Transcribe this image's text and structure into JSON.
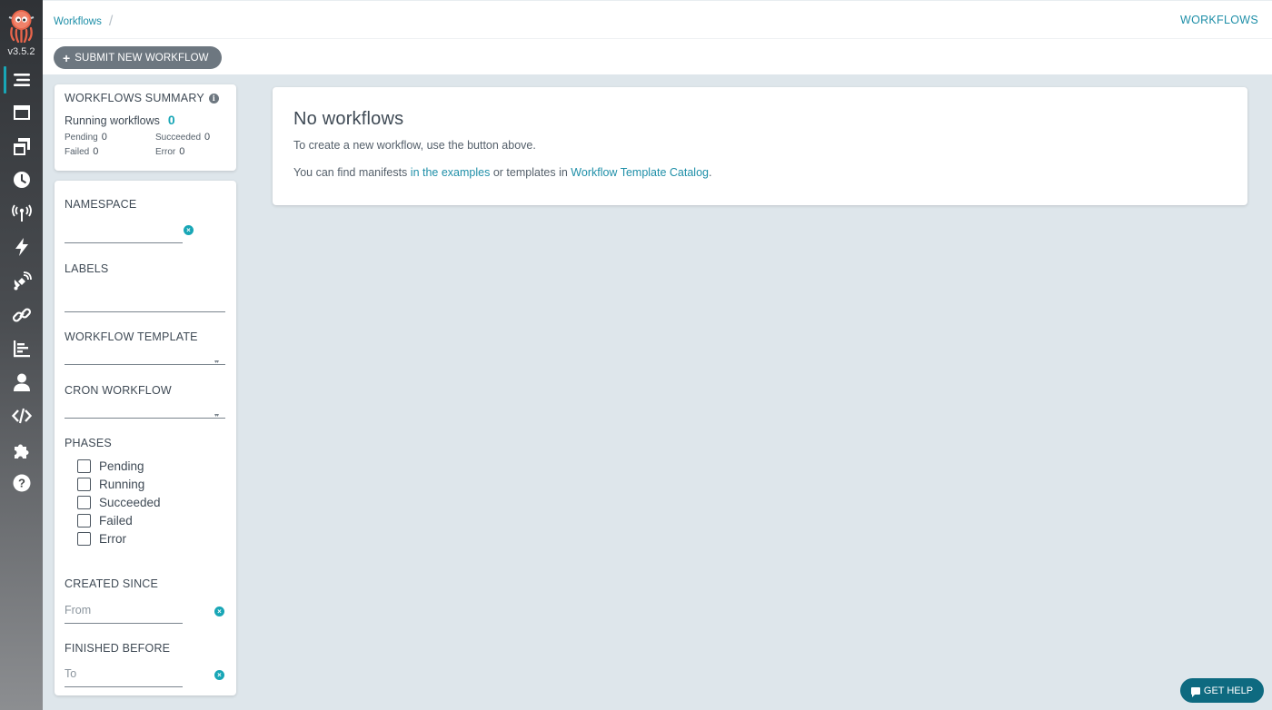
{
  "app": {
    "version": "v3.5.2",
    "colors": {
      "accent": "#18a6b6",
      "link": "#1f8fa8",
      "button": "#6d7780",
      "help": "#0e6a80",
      "background": "#dee6eb"
    }
  },
  "sidebar": {
    "items": [
      {
        "icon": "workflows-list-icon",
        "active": true
      },
      {
        "icon": "workflow-templates-icon"
      },
      {
        "icon": "cluster-workflow-templates-icon"
      },
      {
        "icon": "cron-workflows-clock-icon"
      },
      {
        "icon": "event-sources-antenna-icon"
      },
      {
        "icon": "sensors-bolt-icon"
      },
      {
        "icon": "event-flow-satellite-icon"
      },
      {
        "icon": "api-docs-link-icon"
      },
      {
        "icon": "reports-chart-icon"
      },
      {
        "icon": "user-icon"
      },
      {
        "icon": "api-code-icon"
      },
      {
        "icon": "plugins-puzzle-icon"
      },
      {
        "icon": "help-icon"
      }
    ]
  },
  "header": {
    "breadcrumb": "Workflows",
    "title": "WORKFLOWS",
    "submit_label": "SUBMIT NEW WORKFLOW"
  },
  "summary": {
    "title": "WORKFLOWS SUMMARY",
    "running_label": "Running workflows",
    "running_count": "0",
    "pending_label": "Pending",
    "pending_count": "0",
    "succeeded_label": "Succeeded",
    "succeeded_count": "0",
    "failed_label": "Failed",
    "failed_count": "0",
    "error_label": "Error",
    "error_count": "0"
  },
  "filters": {
    "namespace_label": "NAMESPACE",
    "namespace_value": "",
    "labels_label": "LABELS",
    "labels_value": "",
    "workflow_template_label": "WORKFLOW TEMPLATE",
    "cron_workflow_label": "CRON WORKFLOW",
    "phases_label": "PHASES",
    "phases": [
      "Pending",
      "Running",
      "Succeeded",
      "Failed",
      "Error"
    ],
    "created_since_label": "CREATED SINCE",
    "created_since_placeholder": "From",
    "finished_before_label": "FINISHED BEFORE",
    "finished_before_placeholder": "To"
  },
  "main": {
    "empty_title": "No workflows",
    "empty_text": "To create a new workflow, use the button above.",
    "manifests_prefix": "You can find manifests ",
    "examples_link": "in the examples",
    "templates_middle": " or templates in ",
    "catalog_link": "Workflow Template Catalog",
    "suffix": "."
  },
  "help_button": "GET HELP"
}
